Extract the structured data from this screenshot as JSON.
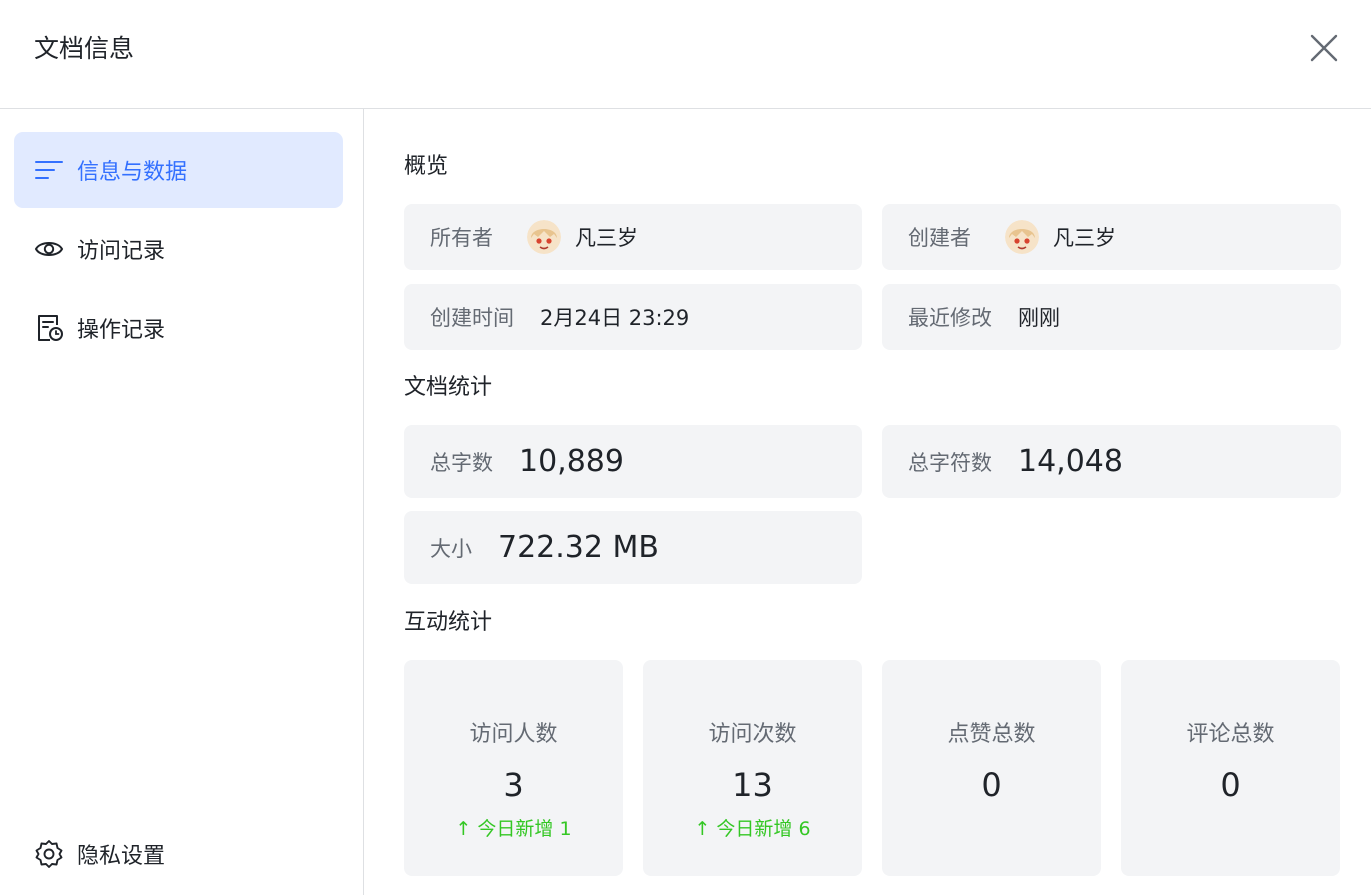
{
  "dialog": {
    "title": "文档信息"
  },
  "sidebar": {
    "items": [
      {
        "label": "信息与数据",
        "icon": "list-icon"
      },
      {
        "label": "访问记录",
        "icon": "eye-icon"
      },
      {
        "label": "操作记录",
        "icon": "history-doc-icon"
      }
    ],
    "footer": {
      "label": "隐私设置",
      "icon": "gear-icon"
    }
  },
  "overview": {
    "title": "概览",
    "owner_label": "所有者",
    "owner_name": "凡三岁",
    "creator_label": "创建者",
    "creator_name": "凡三岁",
    "created_label": "创建时间",
    "created_value": "2月24日 23:29",
    "modified_label": "最近修改",
    "modified_value": "刚刚"
  },
  "doc_stats": {
    "title": "文档统计",
    "words_label": "总字数",
    "words_value": "10,889",
    "chars_label": "总字符数",
    "chars_value": "14,048",
    "size_label": "大小",
    "size_value": "722.32 MB"
  },
  "interaction": {
    "title": "互动统计",
    "cards": [
      {
        "label": "访问人数",
        "value": "3",
        "delta": "↑ 今日新增 1"
      },
      {
        "label": "访问次数",
        "value": "13",
        "delta": "↑ 今日新增 6"
      },
      {
        "label": "点赞总数",
        "value": "0",
        "delta": ""
      },
      {
        "label": "评论总数",
        "value": "0",
        "delta": ""
      }
    ]
  },
  "colors": {
    "accent": "#3370ff",
    "active_bg": "#e1eaff",
    "card_bg": "#f3f4f6",
    "positive": "#34c724"
  }
}
